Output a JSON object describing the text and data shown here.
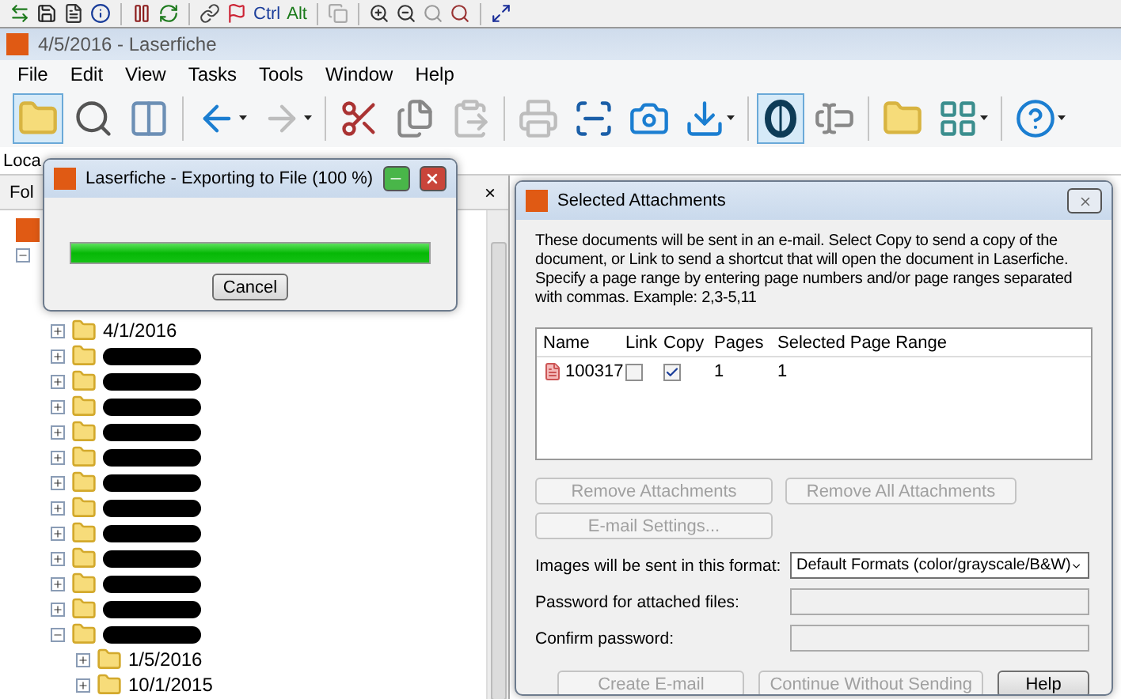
{
  "quick_toolbar": [
    {
      "kind": "transfer"
    },
    {
      "kind": "save"
    },
    {
      "kind": "properties"
    },
    {
      "kind": "info"
    },
    {
      "kind": "separator"
    },
    {
      "kind": "pause"
    },
    {
      "kind": "refresh"
    },
    {
      "kind": "separator"
    },
    {
      "kind": "link"
    },
    {
      "kind": "flag"
    },
    {
      "kind": "key",
      "label": "Ctrl"
    },
    {
      "kind": "key",
      "label": "Alt"
    },
    {
      "kind": "separator"
    },
    {
      "kind": "copy"
    },
    {
      "kind": "separator"
    },
    {
      "kind": "zoom-in"
    },
    {
      "kind": "zoom-out"
    },
    {
      "kind": "zoom-fit"
    },
    {
      "kind": "zoom-search"
    },
    {
      "kind": "separator"
    },
    {
      "kind": "fit-page"
    }
  ],
  "window": {
    "title": "4/5/2016 - Laserfiche"
  },
  "menu": [
    "File",
    "Edit",
    "View",
    "Tasks",
    "Tools",
    "Window",
    "Help"
  ],
  "toolbar": [
    {
      "kind": "folders",
      "selected": true,
      "disabled": false,
      "dropdown": false
    },
    {
      "kind": "search",
      "selected": false,
      "disabled": false,
      "dropdown": false
    },
    {
      "kind": "panel",
      "selected": false,
      "disabled": false,
      "dropdown": false
    },
    {
      "kind": "separator"
    },
    {
      "kind": "back",
      "selected": false,
      "disabled": false,
      "dropdown": true
    },
    {
      "kind": "forward",
      "selected": false,
      "disabled": true,
      "dropdown": true
    },
    {
      "kind": "separator"
    },
    {
      "kind": "cut",
      "selected": false,
      "disabled": false,
      "dropdown": false
    },
    {
      "kind": "copy",
      "selected": false,
      "disabled": false,
      "dropdown": false
    },
    {
      "kind": "paste",
      "selected": false,
      "disabled": true,
      "dropdown": false
    },
    {
      "kind": "separator"
    },
    {
      "kind": "print",
      "selected": false,
      "disabled": true,
      "dropdown": false
    },
    {
      "kind": "scan",
      "selected": false,
      "disabled": false,
      "dropdown": false
    },
    {
      "kind": "camera",
      "selected": false,
      "disabled": false,
      "dropdown": false
    },
    {
      "kind": "download",
      "selected": false,
      "disabled": false,
      "dropdown": true
    },
    {
      "kind": "separator"
    },
    {
      "kind": "ocr",
      "selected": true,
      "disabled": false,
      "dropdown": false
    },
    {
      "kind": "fields",
      "selected": false,
      "disabled": false,
      "dropdown": false
    },
    {
      "kind": "separator"
    },
    {
      "kind": "new-folder",
      "selected": false,
      "disabled": false,
      "dropdown": false
    },
    {
      "kind": "layout",
      "selected": false,
      "disabled": false,
      "dropdown": true
    },
    {
      "kind": "separator"
    },
    {
      "kind": "help",
      "selected": false,
      "disabled": false,
      "dropdown": true
    }
  ],
  "location": {
    "label": "Loca"
  },
  "folder_panel": {
    "title": "Fol",
    "close": "×",
    "tree": {
      "root": {
        "kind": "repository"
      },
      "children": [
        {
          "expanded": true,
          "children": [
            {
              "label": "4/1/2016",
              "redacted": false,
              "expanded": false
            },
            {
              "redacted": true,
              "expanded": false
            },
            {
              "redacted": true,
              "expanded": false
            },
            {
              "redacted": true,
              "expanded": false
            },
            {
              "redacted": true,
              "expanded": false
            },
            {
              "redacted": true,
              "expanded": false
            },
            {
              "redacted": true,
              "expanded": false
            },
            {
              "redacted": true,
              "expanded": false
            },
            {
              "redacted": true,
              "expanded": false
            },
            {
              "redacted": true,
              "expanded": false
            },
            {
              "redacted": true,
              "expanded": false
            },
            {
              "redacted": true,
              "expanded": false
            },
            {
              "redacted": true,
              "expanded": true,
              "children": [
                {
                  "label": "1/5/2016",
                  "redacted": false,
                  "expanded": false
                },
                {
                  "label": "10/1/2015",
                  "redacted": false,
                  "expanded": false
                }
              ]
            }
          ]
        }
      ]
    }
  },
  "export_dialog": {
    "title": "Laserfiche - Exporting to File (100 %)",
    "level": 1,
    "cancel": "Cancel"
  },
  "attachments_dialog": {
    "title": "Selected Attachments",
    "description": "These documents will be sent in an e-mail. Select Copy to send a copy of the document, or Link to send a shortcut that will open the document in Laserfiche.  Specify a page range by entering page numbers and/or page ranges separated with commas.  Example: 2,3-5,11",
    "columns": [
      "Name",
      "Link",
      "Copy",
      "Pages",
      "Selected Page Range"
    ],
    "rows": [
      {
        "name": "100317",
        "link": false,
        "copy": true,
        "pages": "1",
        "range": "1"
      }
    ],
    "actions": [
      {
        "label": "Remove Attachments",
        "disabled": true
      },
      {
        "label": "Remove All Attachments",
        "disabled": true
      },
      {
        "label": "E-mail Settings...",
        "disabled": true
      }
    ],
    "format_label": "Images will be sent in this format:",
    "format_value": "Default Formats (color/grayscale/B&W)",
    "password_label": "Password for attached files:",
    "confirm_label": "Confirm password:",
    "buttons": [
      {
        "label": "Create E-mail",
        "disabled": true
      },
      {
        "label": "Continue Without Sending",
        "disabled": true
      },
      {
        "label": "Help",
        "disabled": false
      }
    ]
  }
}
